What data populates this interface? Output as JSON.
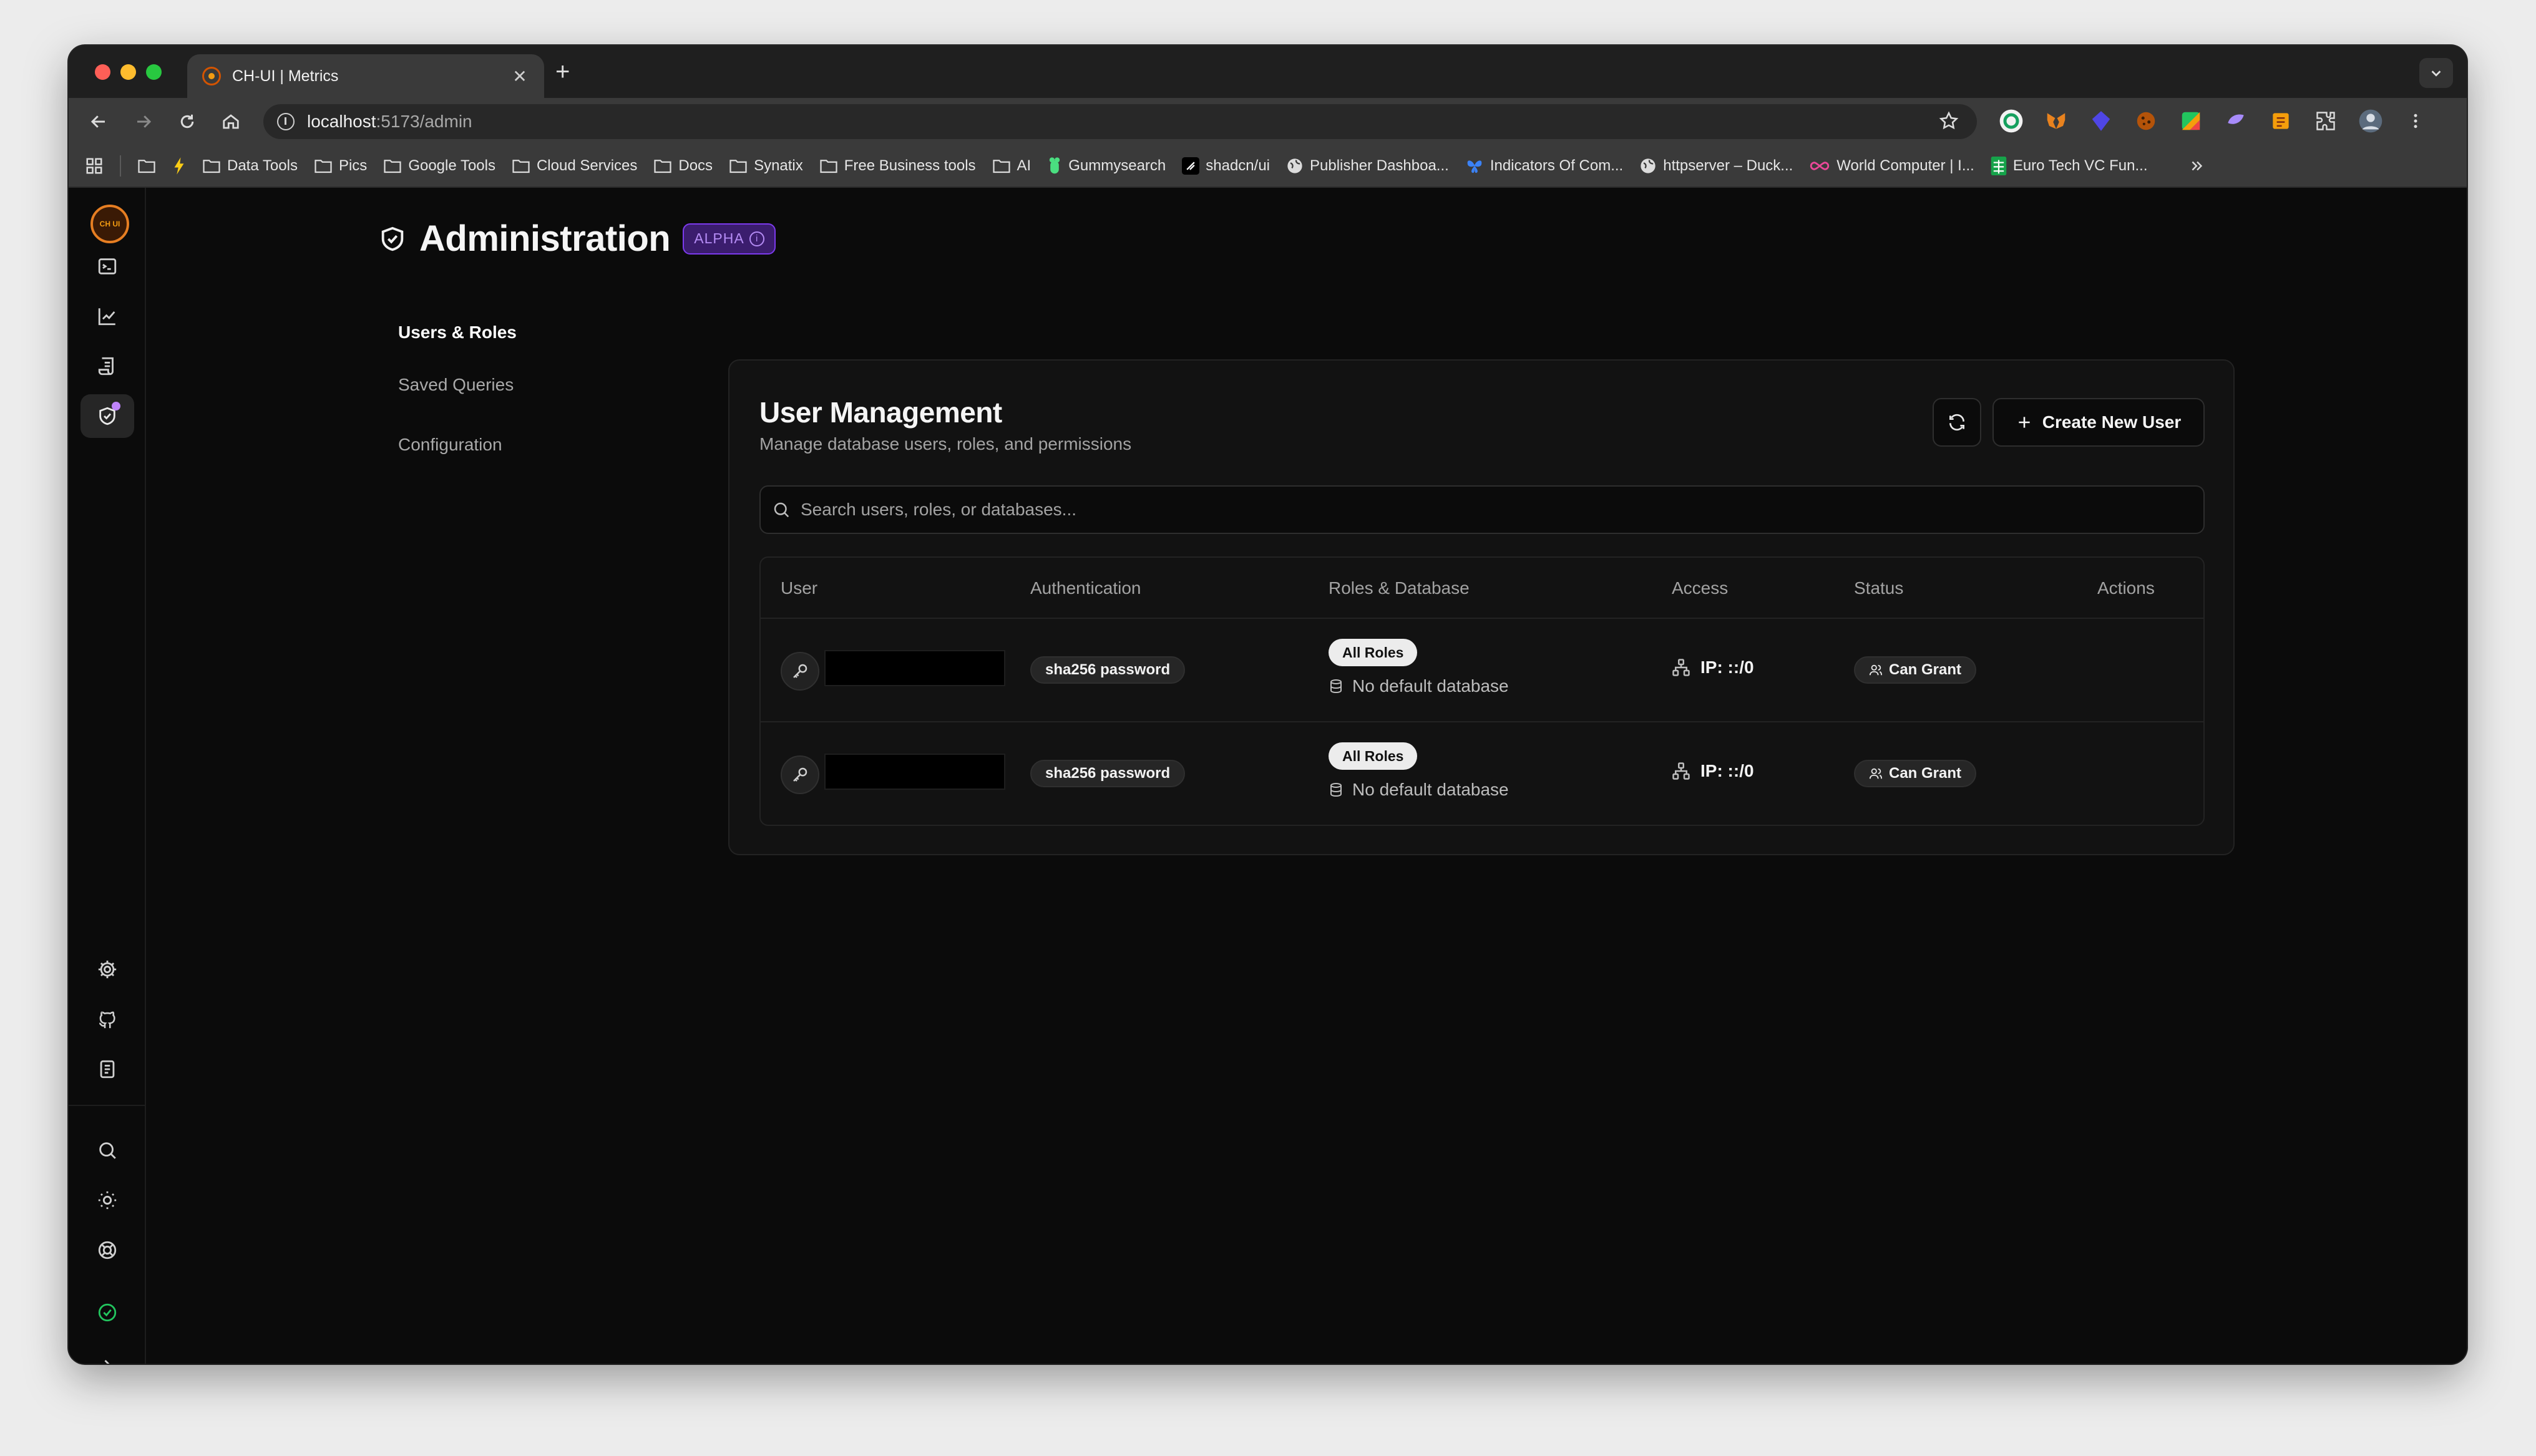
{
  "browser": {
    "tab_title": "CH-UI | Metrics",
    "url_host": "localhost",
    "url_path": ":5173/admin",
    "bookmarks": [
      {
        "label": "Data Tools"
      },
      {
        "label": "Pics"
      },
      {
        "label": "Google Tools"
      },
      {
        "label": "Cloud Services"
      },
      {
        "label": "Docs"
      },
      {
        "label": "Synatix"
      },
      {
        "label": "Free Business tools"
      },
      {
        "label": "AI"
      },
      {
        "label": "Gummysearch"
      },
      {
        "label": "shadcn/ui"
      },
      {
        "label": "Publisher Dashboa..."
      },
      {
        "label": "Indicators Of Com..."
      },
      {
        "label": "httpserver – Duck..."
      },
      {
        "label": "World Computer | I..."
      },
      {
        "label": "Euro Tech VC Fun..."
      }
    ]
  },
  "app": {
    "logo_text": "CH UI",
    "page_title": "Administration",
    "badge": "ALPHA",
    "subnav": [
      "Users & Roles",
      "Saved Queries",
      "Configuration"
    ],
    "card": {
      "title": "User Management",
      "subtitle": "Manage database users, roles, and permissions",
      "create_label": "Create New User",
      "search_placeholder": "Search users, roles, or databases...",
      "columns": [
        "User",
        "Authentication",
        "Roles & Database",
        "Access",
        "Status",
        "Actions"
      ],
      "rows": [
        {
          "auth": "sha256 password",
          "role": "All Roles",
          "database": "No default database",
          "access": "IP: ::/0",
          "status": "Can Grant"
        },
        {
          "auth": "sha256 password",
          "role": "All Roles",
          "database": "No default database",
          "access": "IP: ::/0",
          "status": "Can Grant"
        }
      ]
    }
  },
  "colors": {
    "accent_purple": "#7c3aed",
    "logo_orange": "#e67e22",
    "status_green": "#22c55e"
  }
}
